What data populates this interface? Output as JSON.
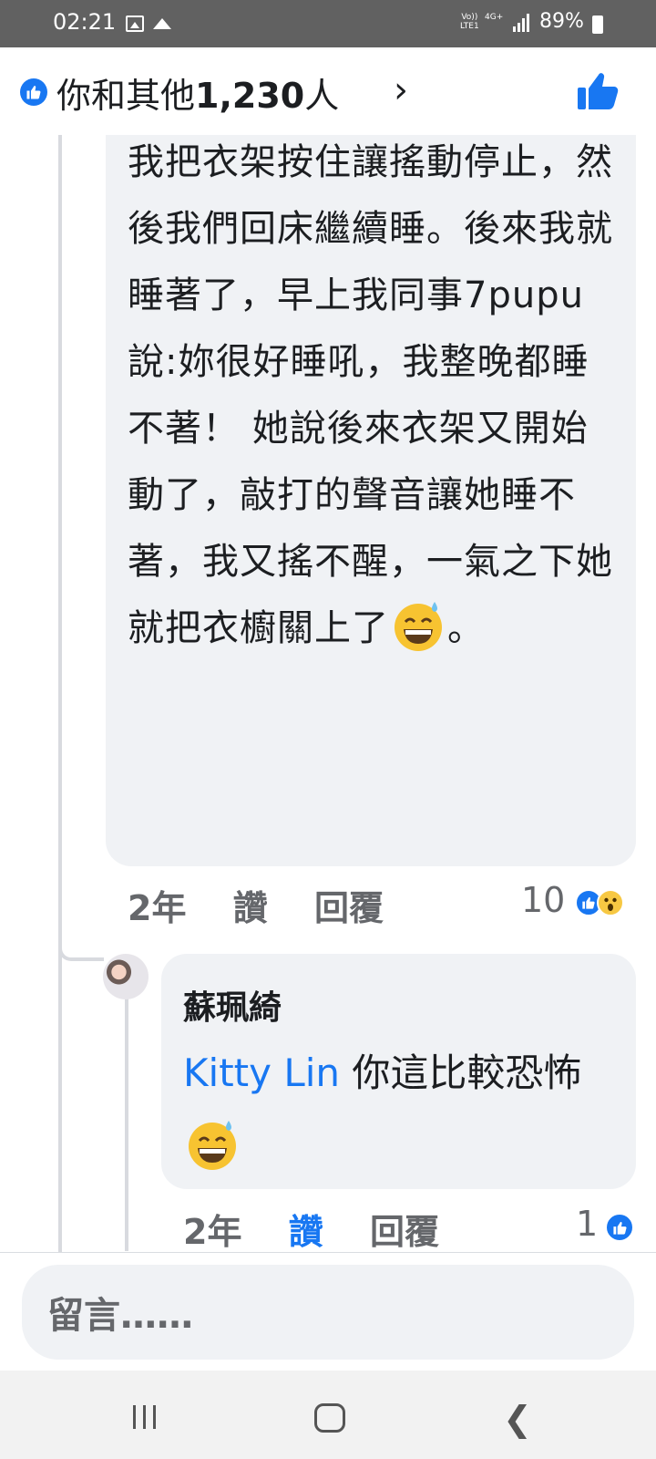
{
  "status_bar": {
    "time": "02:21",
    "network_top": "Vo))",
    "network_bottom": "LTE1",
    "network_4g": "4G+",
    "battery": "89%"
  },
  "header": {
    "reactions_prefix": "你和其他",
    "reactions_count": "1,230",
    "reactions_suffix": "人",
    "chevron": "›"
  },
  "comment": {
    "text": "我把衣架按住讓搖動停止，然後我們回床繼續睡。後來我就睡著了，早上我同事7pupu說:妳很好睡吼，我整晚都睡不著！ 她說後來衣架又開始動了，敲打的聲音讓她睡不著，我又搖不醒，一氣之下她就把衣櫥關上了",
    "text_end": "。",
    "emoji": "grinning-sweat-emoji",
    "time": "2年",
    "like_label": "讚",
    "reply_label": "回覆",
    "reaction_count": "10",
    "reactions": [
      "like-icon",
      "wow-icon"
    ]
  },
  "reply": {
    "author": "蘇珮綺",
    "mention": "Kitty Lin",
    "text": " 你這比較恐怖",
    "emoji": "grinning-sweat-emoji",
    "time": "2年",
    "like_label": "讚",
    "reply_label": "回覆",
    "reaction_count": "1",
    "liked": true
  },
  "composer": {
    "placeholder": "留言……"
  },
  "colors": {
    "accent": "#1877f2",
    "bubble": "#f0f2f5",
    "meta": "#65676b"
  }
}
